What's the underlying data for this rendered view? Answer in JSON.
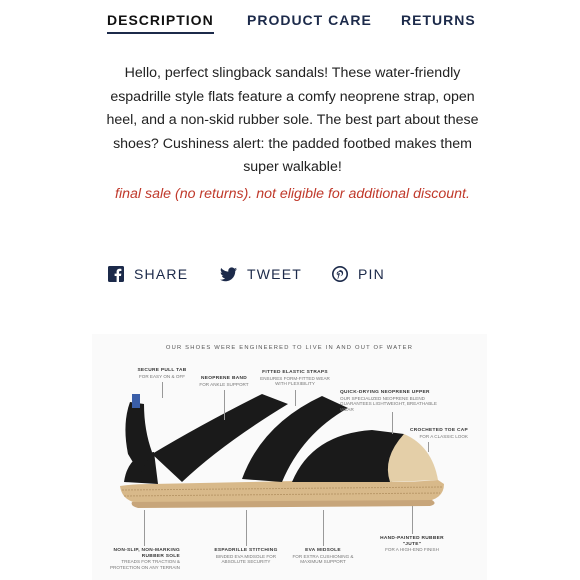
{
  "tabs": {
    "description": "DESCRIPTION",
    "product_care": "PRODUCT CARE",
    "returns": "RETURNS"
  },
  "description": "Hello, perfect slingback sandals! These water-friendly espadrille style flats feature a comfy neoprene strap, open heel, and a non-skid rubber sole. The best part about these shoes? Cushiness alert: the padded footbed makes them super walkable!",
  "sale_notice": "final sale (no returns). not eligible for additional discount.",
  "share": {
    "share_label": "SHARE",
    "tweet_label": "TWEET",
    "pin_label": "PIN",
    "icons": [
      "facebook-icon",
      "twitter-icon",
      "pinterest-icon"
    ]
  },
  "banner": {
    "title": "OUR SHOES WERE ENGINEERED TO LIVE IN AND OUT OF WATER",
    "callouts": [
      {
        "title": "SECURE PULL TAB",
        "text": "FOR EASY ON & OFF"
      },
      {
        "title": "NEOPRENE BAND",
        "text": "FOR ANKLE SUPPORT"
      },
      {
        "title": "FITTED ELASTIC STRAPS",
        "text": "ENSURES FORM-FITTED WEAR WITH FLEXIBILITY"
      },
      {
        "title": "QUICK-DRYING NEOPRENE UPPER",
        "text": "OUR SPECIALIZED NEOPRENE BLEND GUARANTEES LIGHTWEIGHT, BREATHABLE WEAR"
      },
      {
        "title": "CROCHETED TOE CAP",
        "text": "FOR A CLASSIC LOOK"
      },
      {
        "title": "NON-SLIP, NON-MARKING RUBBER SOLE",
        "text": "TREADS FOR TRACTION & PROTECTION ON ANY TERRAIN"
      },
      {
        "title": "ESPADRILLE STITCHING",
        "text": "BINDED EVA MIDSOLE FOR ABSOLUTE SECURITY"
      },
      {
        "title": "EVA MIDSOLE",
        "text": "FOR EXTRA CUSHIONING & MAXIMUM SUPPORT"
      },
      {
        "title": "HAND-PAINTED RUBBER \"JUTE\"",
        "text": "FOR A HIGH-END FINISH"
      }
    ]
  },
  "colors": {
    "navy": "#1c2a4a",
    "sale_red": "#c0392b",
    "jute": "#d8b98a",
    "strap_black": "#1a1a1a"
  }
}
